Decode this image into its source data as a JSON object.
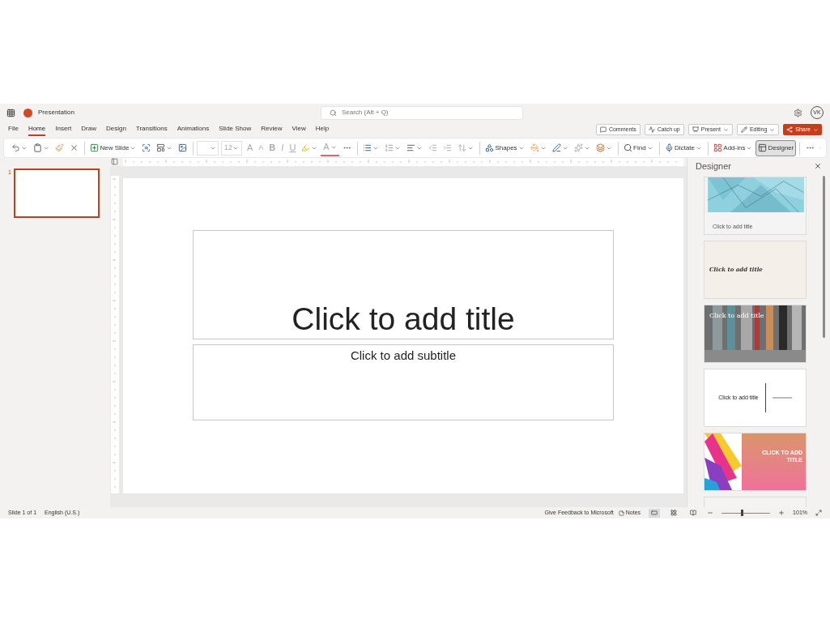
{
  "title_bar": {
    "app_name": "Presentation",
    "search": {
      "placeholder": "Search (Alt + Q)"
    },
    "avatar": "VK"
  },
  "menu_tabs": [
    {
      "label": "File",
      "selected": false
    },
    {
      "label": "Home",
      "selected": true
    },
    {
      "label": "Insert",
      "selected": false
    },
    {
      "label": "Draw",
      "selected": false
    },
    {
      "label": "Design",
      "selected": false
    },
    {
      "label": "Transitions",
      "selected": false
    },
    {
      "label": "Animations",
      "selected": false
    },
    {
      "label": "Slide Show",
      "selected": false
    },
    {
      "label": "Review",
      "selected": false
    },
    {
      "label": "View",
      "selected": false
    },
    {
      "label": "Help",
      "selected": false
    }
  ],
  "actions": [
    {
      "kind": "comments",
      "label": "Comments"
    },
    {
      "kind": "catchup",
      "label": "Catch up"
    },
    {
      "kind": "present",
      "label": "Present"
    },
    {
      "kind": "editing",
      "label": "Editing"
    },
    {
      "kind": "share",
      "label": "Share"
    }
  ],
  "ribbon": [
    {
      "kind": "undo",
      "menu": true
    },
    {
      "kind": "paste",
      "menu": true
    },
    {
      "kind": "brush",
      "menu": false
    },
    {
      "kind": "clear",
      "menu": false
    },
    {
      "kind": "sep"
    },
    {
      "kind": "new_slide",
      "label": "New Slide",
      "menu": true,
      "on": false
    },
    {
      "kind": "reuse",
      "menu": false
    },
    {
      "kind": "layout",
      "menu": true
    },
    {
      "kind": "background",
      "menu": false
    },
    {
      "kind": "sep"
    },
    {
      "kind": "font_name",
      "menu": true
    },
    {
      "kind": "font_size",
      "label": "12",
      "menu": true
    },
    {
      "kind": "grow",
      "label": "A",
      "menu": false
    },
    {
      "kind": "shrink",
      "label": "A",
      "menu": false
    },
    {
      "kind": "bold",
      "label": "B",
      "menu": false
    },
    {
      "kind": "italic",
      "label": "I",
      "menu": false
    },
    {
      "kind": "underline",
      "label": "U",
      "menu": false
    },
    {
      "kind": "highlight",
      "menu": true
    },
    {
      "kind": "font_color",
      "label": "A",
      "menu": true
    },
    {
      "kind": "more",
      "menu": false
    },
    {
      "kind": "sep"
    },
    {
      "kind": "bullets",
      "menu": true
    },
    {
      "kind": "numbering",
      "menu": true
    },
    {
      "kind": "align",
      "menu": true
    },
    {
      "kind": "outdent",
      "menu": false
    },
    {
      "kind": "indent",
      "menu": false
    },
    {
      "kind": "spacing",
      "menu": true
    },
    {
      "kind": "sep"
    },
    {
      "kind": "shapes",
      "label": "Shapes",
      "menu": true,
      "on": false
    },
    {
      "kind": "fill",
      "menu": true
    },
    {
      "kind": "outline",
      "menu": true
    },
    {
      "kind": "effects",
      "menu": true
    },
    {
      "kind": "arrange",
      "menu": true
    },
    {
      "kind": "sep"
    },
    {
      "kind": "find",
      "label": "Find",
      "menu": true,
      "on": false
    },
    {
      "kind": "sep"
    },
    {
      "kind": "dictate",
      "label": "Dictate",
      "menu": true,
      "on": false
    },
    {
      "kind": "sep"
    },
    {
      "kind": "addins",
      "label": "Add-ins",
      "menu": true,
      "on": false
    },
    {
      "kind": "designer",
      "label": "Designer",
      "menu": false,
      "on": true
    },
    {
      "kind": "sep"
    },
    {
      "kind": "more",
      "menu": false
    }
  ],
  "slides_panel": [
    {
      "number": "1",
      "selected": true
    }
  ],
  "slide": {
    "title": "Click to add title",
    "subtitle": "Click to add subtitle"
  },
  "designer": {
    "title": "Designer",
    "designs": [
      {
        "kind": "network",
        "title": "Click to add title"
      },
      {
        "kind": "blush",
        "title": "Click to add title"
      },
      {
        "title": "Click to add title"
      },
      {
        "kind": "minimal",
        "title": "Click to add title"
      },
      {
        "kind": "paint",
        "title": "CLICK TO ADD TITLE"
      },
      {
        "kind": "partial"
      }
    ]
  },
  "status_bar": {
    "slide_count": "Slide 1 of 1",
    "language": "English (U.S.)",
    "feedback": "Give Feedback to Microsoft",
    "notes": "Notes",
    "views": [
      {
        "kind": "normal",
        "selected": true
      },
      {
        "kind": "sorter",
        "selected": false
      },
      {
        "kind": "reading",
        "selected": false
      }
    ],
    "zoom": {
      "level": 0.4,
      "reading": "101%"
    }
  }
}
